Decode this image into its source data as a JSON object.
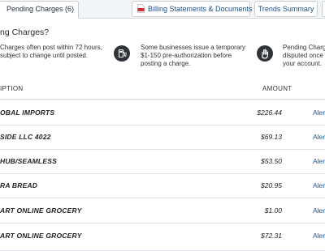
{
  "tabs": {
    "pending_label": "Pending Charges (6)",
    "billing_label": "Billing Statements & Documents",
    "trends_label": "Trends Summary"
  },
  "info": {
    "question": "ng Charges?",
    "tip1_line1": "Charges often post within 72 hours,",
    "tip1_line2": "subject to change until posted.",
    "tip2_line1": "Some businesses issue a temporary",
    "tip2_line2": "$1-150 pre-authorization before",
    "tip2_line3": "posting a charge.",
    "tip3_line1": "Pending Charge",
    "tip3_line2": "disputed once t",
    "tip3_line3": "your account.",
    "icons": [
      "gas-pump-icon",
      "hand-stop-icon"
    ]
  },
  "table": {
    "header_description": "IPTION",
    "header_amount": "AMOUNT",
    "rows": [
      {
        "description": "OBAL IMPORTS",
        "amount": "$226.44",
        "alert": "Aler"
      },
      {
        "description": "SIDE LLC 4022",
        "amount": "$69.13",
        "alert": "Aler"
      },
      {
        "description": "HUB/SEAMLESS",
        "amount": "$53.50",
        "alert": "Aler"
      },
      {
        "description": "RA BREAD",
        "amount": "$20.95",
        "alert": "Aler"
      },
      {
        "description": "ART ONLINE GROCERY",
        "amount": "$1.00",
        "alert": "Aler"
      },
      {
        "description": "ART ONLINE GROCERY",
        "amount": "$72.31",
        "alert": "Aler"
      }
    ]
  },
  "colors": {
    "link": "#1a5aa6",
    "icon_bg": "#2f3338",
    "pdf_red": "#d0312d"
  }
}
